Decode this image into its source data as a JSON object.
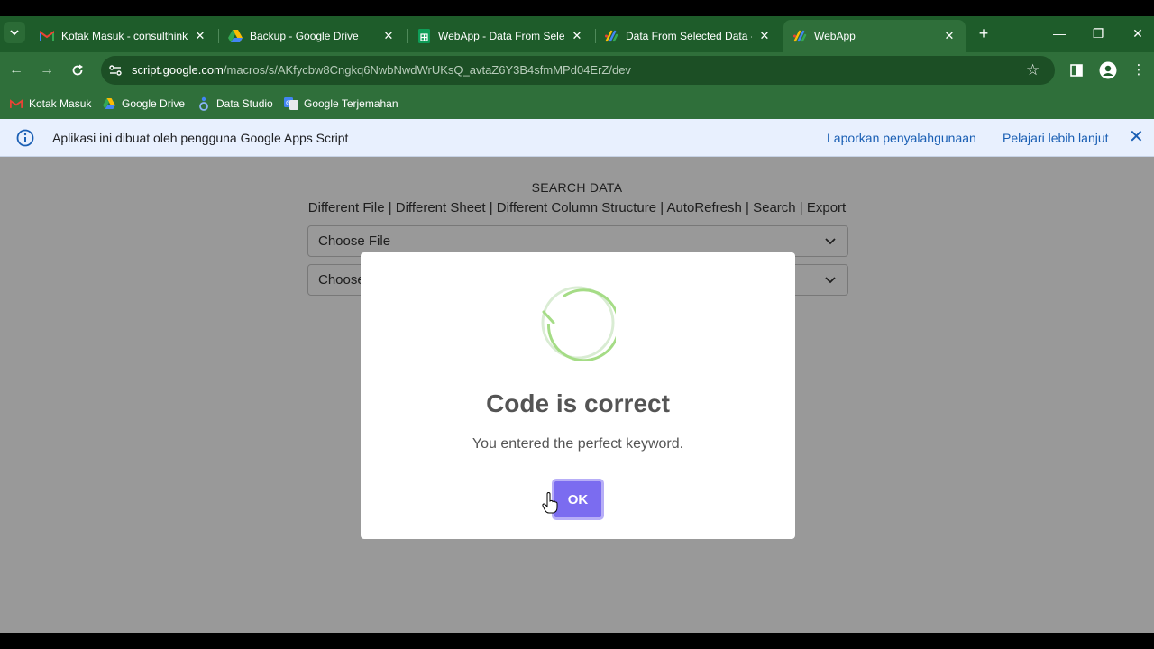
{
  "browser": {
    "tabs": [
      {
        "title": "Kotak Masuk - consulthinkpro",
        "icon": "gmail-icon",
        "active": false
      },
      {
        "title": "Backup - Google Drive",
        "icon": "google-drive-icon",
        "active": false
      },
      {
        "title": "WebApp - Data From Selected",
        "icon": "google-sheets-icon",
        "active": false
      },
      {
        "title": "Data From Selected Data - E",
        "icon": "apps-script-icon",
        "active": false
      },
      {
        "title": "WebApp",
        "icon": "apps-script-icon",
        "active": true
      }
    ],
    "new_tab_symbol": "+",
    "window_controls": {
      "minimize": "—",
      "restore": "❐",
      "close": "✕"
    },
    "url_host": "script.google.com",
    "url_path": "/macros/s/AKfycbw8Cngkq6NwbNwdWrUKsQ_avtaZ6Y3B4sfmMPd04ErZ/dev",
    "bookmarks": [
      {
        "label": "Kotak Masuk",
        "icon": "gmail-icon"
      },
      {
        "label": "Google Drive",
        "icon": "google-drive-icon"
      },
      {
        "label": "Data Studio",
        "icon": "data-studio-icon"
      },
      {
        "label": "Google Terjemahan",
        "icon": "google-translate-icon"
      }
    ],
    "colors": {
      "frame": "#1e5c2a",
      "toolbar": "#2f6f3a"
    }
  },
  "infobar": {
    "text": "Aplikasi ini dibuat oleh pengguna Google Apps Script",
    "report_link": "Laporkan penyalahgunaan",
    "learn_link": "Pelajari lebih lanjut"
  },
  "page": {
    "heading": "SEARCH DATA",
    "menu": "Different File | Different Sheet | Different Column Structure | AutoRefresh | Search | Export",
    "file_select": "Choose File",
    "sheet_select": "Choose Sheet"
  },
  "modal": {
    "title": "Code is correct",
    "text": "You entered the perfect keyword.",
    "ok_label": "OK",
    "accent_color": "#7b6cf0"
  }
}
